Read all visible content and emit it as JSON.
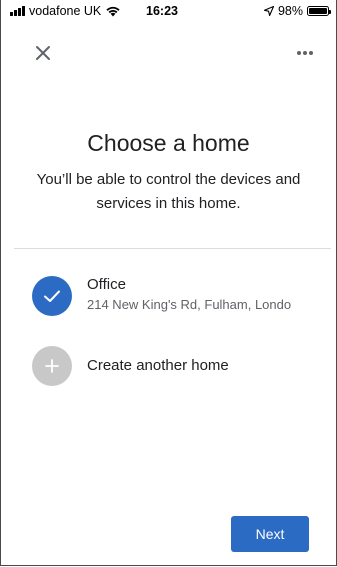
{
  "status_bar": {
    "carrier": "vodafone UK",
    "time": "16:23",
    "battery": "98%",
    "icons": [
      "signal-icon",
      "wifi-icon",
      "location-arrow-icon",
      "battery-icon"
    ]
  },
  "toolbar": {
    "close_icon": "close-icon",
    "more_icon": "more-icon"
  },
  "header": {
    "title": "Choose a home",
    "subtitle": "You’ll be able to control the devices and services in this home."
  },
  "homes": [
    {
      "name": "Office",
      "address": "214 New King's Rd, Fulham, Londo",
      "selected": true,
      "icon": "check-icon"
    }
  ],
  "create_home": {
    "label": "Create another home",
    "icon": "plus-icon"
  },
  "actions": {
    "next_label": "Next"
  },
  "colors": {
    "accent": "#2c6bc4",
    "disabled": "#c8c8c8",
    "text": "#202124",
    "secondary_text": "#5f6368"
  }
}
